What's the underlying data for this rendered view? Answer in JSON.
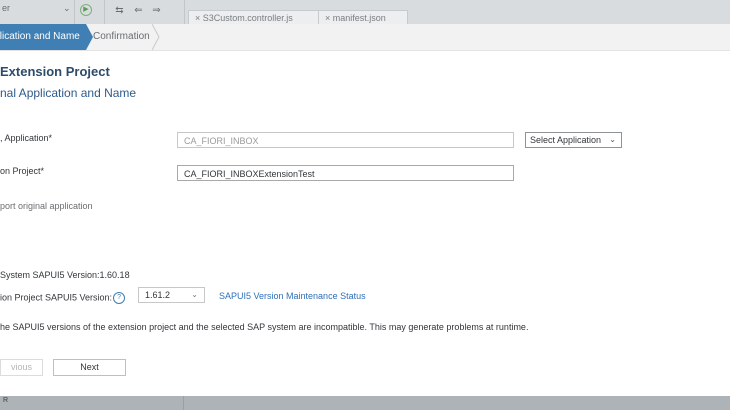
{
  "ide": {
    "top_left_text": "er",
    "tabs": [
      "S3Custom.controller.js",
      "manifest.json"
    ],
    "bottom_text": "R"
  },
  "wizard": {
    "steps": [
      {
        "label": "Application and Name",
        "state": "active"
      },
      {
        "label": "Confirmation",
        "state": "inactive"
      }
    ],
    "title": "Extension Project",
    "subtitle": "nal Application and Name"
  },
  "form": {
    "parent_app_label": ", Application*",
    "parent_app_value": "CA_FIORI_INBOX",
    "select_app_button": "Select Application",
    "ext_project_label": "on Project*",
    "ext_project_value": "CA_FIORI_INBOXExtensionTest",
    "import_checkbox_label": "port original application",
    "system_version": "System SAPUI5 Version:1.60.18",
    "ext_version_label": "ion Project SAPUI5 Version:",
    "ext_version_value": "1.61.2",
    "maintenance_link": "SAPUI5 Version Maintenance Status",
    "warning": "he SAPUI5 versions of the extension project and the selected SAP system are incompatible. This may generate problems at runtime."
  },
  "buttons": {
    "previous": "vious",
    "next": "Next"
  },
  "colors": {
    "step_active": "#3f7fb3",
    "title": "#2d4b6b",
    "link": "#2f70b8"
  },
  "icons": [
    "chevron-down-icon",
    "help-icon",
    "step-arrow-icon"
  ]
}
